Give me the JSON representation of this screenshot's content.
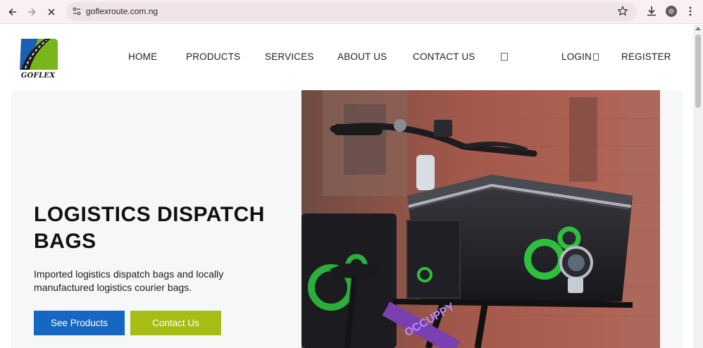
{
  "browser": {
    "url": "goflexroute.com.ng"
  },
  "site": {
    "logo_text": "GOFLEX",
    "nav": {
      "items": [
        {
          "label": "HOME"
        },
        {
          "label": "PRODUCTS"
        },
        {
          "label": "SERVICES"
        },
        {
          "label": "ABOUT US"
        },
        {
          "label": "CONTACT US"
        }
      ],
      "login_label": "LOGIN",
      "register_label": "REGISTER"
    },
    "hero": {
      "title": "LOGISTICS DISPATCH BAGS",
      "subtitle": "Imported logistics dispatch bags and locally manufactured logistics courier bags.",
      "primary_button": "See Products",
      "secondary_button": "Contact Us",
      "image_brand_text": "OCCUPPY"
    }
  },
  "colors": {
    "primary_button": "#1567c3",
    "secondary_button": "#a6bd14",
    "brand_green": "#7bb51c",
    "brand_blue": "#1a5fb4"
  }
}
